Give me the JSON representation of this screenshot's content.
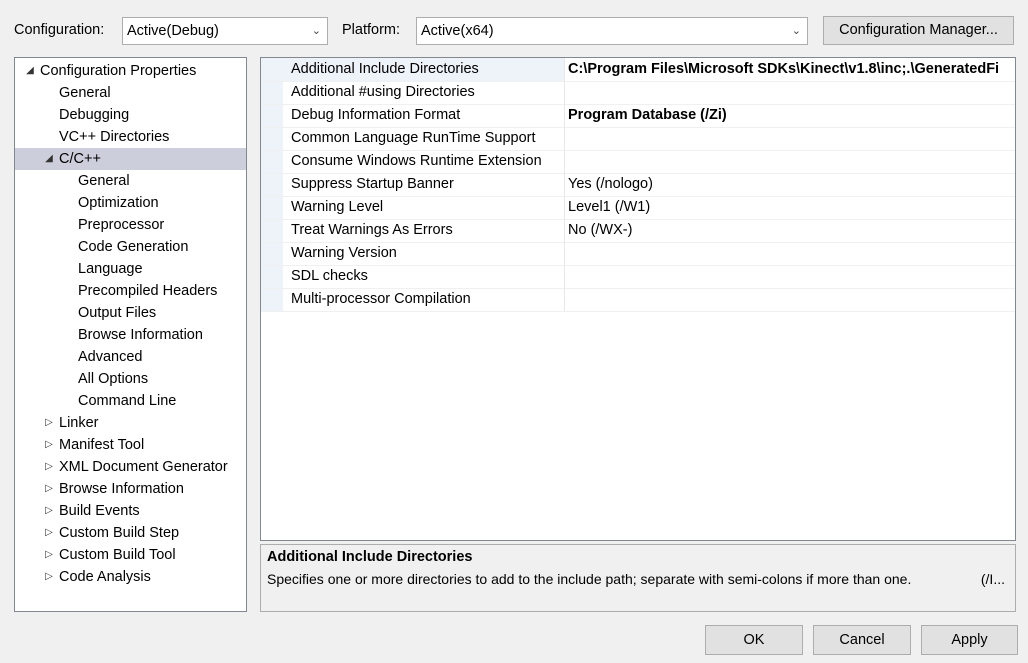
{
  "toolbar": {
    "configuration_label": "Configuration:",
    "configuration_value": "Active(Debug)",
    "platform_label": "Platform:",
    "platform_value": "Active(x64)",
    "config_manager_label": "Configuration Manager..."
  },
  "tree": [
    {
      "label": "Configuration Properties",
      "level": 0,
      "expander": "expanded",
      "selected": false
    },
    {
      "label": "General",
      "level": 1,
      "expander": "none",
      "selected": false
    },
    {
      "label": "Debugging",
      "level": 1,
      "expander": "none",
      "selected": false
    },
    {
      "label": "VC++ Directories",
      "level": 1,
      "expander": "none",
      "selected": false
    },
    {
      "label": "C/C++",
      "level": 1,
      "expander": "expanded",
      "selected": true
    },
    {
      "label": "General",
      "level": 2,
      "expander": "none",
      "selected": false
    },
    {
      "label": "Optimization",
      "level": 2,
      "expander": "none",
      "selected": false
    },
    {
      "label": "Preprocessor",
      "level": 2,
      "expander": "none",
      "selected": false
    },
    {
      "label": "Code Generation",
      "level": 2,
      "expander": "none",
      "selected": false
    },
    {
      "label": "Language",
      "level": 2,
      "expander": "none",
      "selected": false
    },
    {
      "label": "Precompiled Headers",
      "level": 2,
      "expander": "none",
      "selected": false
    },
    {
      "label": "Output Files",
      "level": 2,
      "expander": "none",
      "selected": false
    },
    {
      "label": "Browse Information",
      "level": 2,
      "expander": "none",
      "selected": false
    },
    {
      "label": "Advanced",
      "level": 2,
      "expander": "none",
      "selected": false
    },
    {
      "label": "All Options",
      "level": 2,
      "expander": "none",
      "selected": false
    },
    {
      "label": "Command Line",
      "level": 2,
      "expander": "none",
      "selected": false
    },
    {
      "label": "Linker",
      "level": 1,
      "expander": "collapsed",
      "selected": false
    },
    {
      "label": "Manifest Tool",
      "level": 1,
      "expander": "collapsed",
      "selected": false
    },
    {
      "label": "XML Document Generator",
      "level": 1,
      "expander": "collapsed",
      "selected": false
    },
    {
      "label": "Browse Information",
      "level": 1,
      "expander": "collapsed",
      "selected": false
    },
    {
      "label": "Build Events",
      "level": 1,
      "expander": "collapsed",
      "selected": false
    },
    {
      "label": "Custom Build Step",
      "level": 1,
      "expander": "collapsed",
      "selected": false
    },
    {
      "label": "Custom Build Tool",
      "level": 1,
      "expander": "collapsed",
      "selected": false
    },
    {
      "label": "Code Analysis",
      "level": 1,
      "expander": "collapsed",
      "selected": false
    }
  ],
  "properties": [
    {
      "name": "Additional Include Directories",
      "value": "C:\\Program Files\\Microsoft SDKs\\Kinect\\v1.8\\inc;.\\GeneratedFi",
      "bold": true,
      "selected": true
    },
    {
      "name": "Additional #using Directories",
      "value": "",
      "bold": false,
      "selected": false
    },
    {
      "name": "Debug Information Format",
      "value": "Program Database (/Zi)",
      "bold": true,
      "selected": false
    },
    {
      "name": "Common Language RunTime Support",
      "value": "",
      "bold": false,
      "selected": false
    },
    {
      "name": "Consume Windows Runtime Extension",
      "value": "",
      "bold": false,
      "selected": false
    },
    {
      "name": "Suppress Startup Banner",
      "value": "Yes (/nologo)",
      "bold": false,
      "selected": false
    },
    {
      "name": "Warning Level",
      "value": "Level1 (/W1)",
      "bold": false,
      "selected": false
    },
    {
      "name": "Treat Warnings As Errors",
      "value": "No (/WX-)",
      "bold": false,
      "selected": false
    },
    {
      "name": "Warning Version",
      "value": "",
      "bold": false,
      "selected": false
    },
    {
      "name": "SDL checks",
      "value": "",
      "bold": false,
      "selected": false
    },
    {
      "name": "Multi-processor Compilation",
      "value": "",
      "bold": false,
      "selected": false
    }
  ],
  "description": {
    "title": "Additional Include Directories",
    "text": "Specifies one or more directories to add to the include path; separate with semi-colons if more than one.",
    "tail": "(/I..."
  },
  "buttons": {
    "ok": "OK",
    "cancel": "Cancel",
    "apply": "Apply"
  },
  "icons": {
    "expanded": "triangle-down-right-icon",
    "collapsed": "triangle-right-outline-icon"
  }
}
